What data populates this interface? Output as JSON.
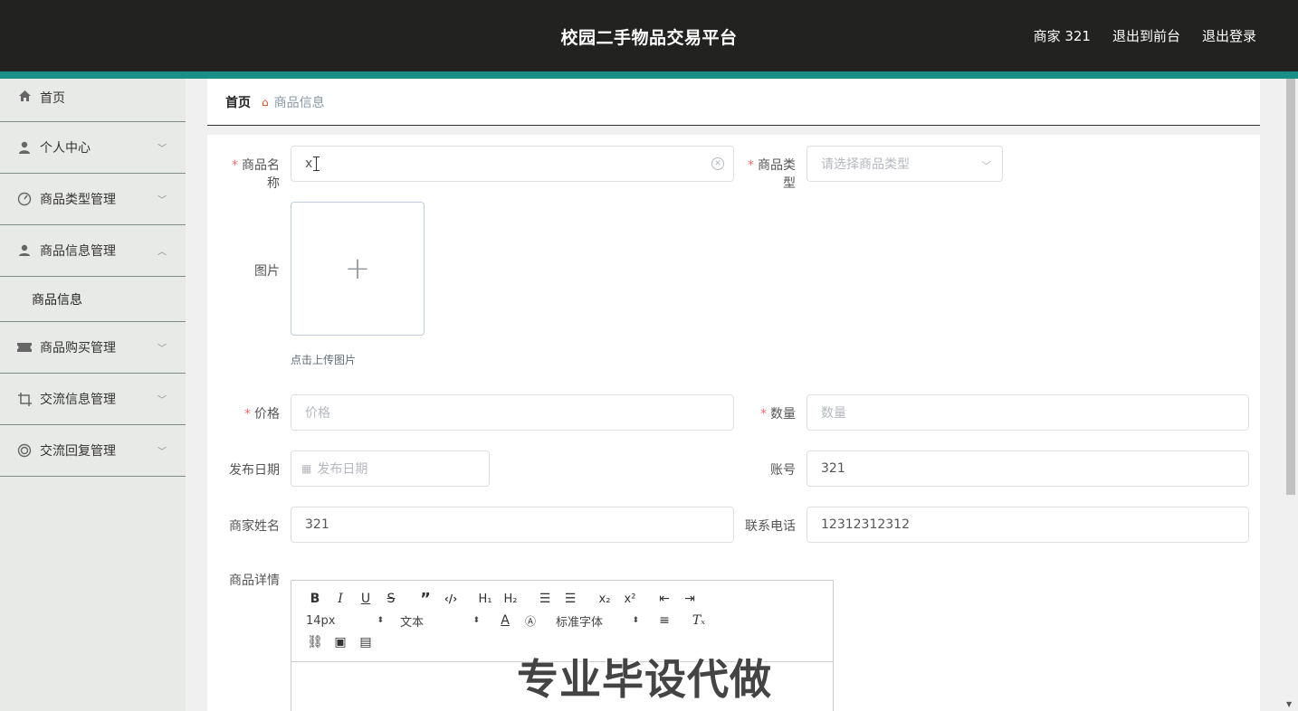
{
  "header": {
    "title": "校园二手物品交易平台",
    "user": "商家 321",
    "front_link": "退出到前台",
    "logout_link": "退出登录"
  },
  "sidebar": {
    "items": [
      {
        "label": "首页",
        "icon": "home-icon"
      },
      {
        "label": "个人中心",
        "icon": "user-icon",
        "arrow": "down"
      },
      {
        "label": "商品类型管理",
        "icon": "dashboard-icon",
        "arrow": "down"
      },
      {
        "label": "商品信息管理",
        "icon": "user-icon",
        "arrow": "up"
      },
      {
        "label": "商品购买管理",
        "icon": "ticket-icon",
        "arrow": "down"
      },
      {
        "label": "交流信息管理",
        "icon": "crop-icon",
        "arrow": "down"
      },
      {
        "label": "交流回复管理",
        "icon": "circle-icon",
        "arrow": "down"
      }
    ],
    "submenu": "商品信息"
  },
  "breadcrumb": {
    "home": "首页",
    "current": "商品信息"
  },
  "form": {
    "name_label": "商品名称",
    "name_value": "x",
    "type_label": "商品类型",
    "type_placeholder": "请选择商品类型",
    "image_label": "图片",
    "upload_tip": "点击上传图片",
    "price_label": "价格",
    "price_placeholder": "价格",
    "qty_label": "数量",
    "qty_placeholder": "数量",
    "date_label": "发布日期",
    "date_placeholder": "发布日期",
    "account_label": "账号",
    "account_value": "321",
    "merchant_label": "商家姓名",
    "merchant_value": "321",
    "phone_label": "联系电话",
    "phone_value": "12312312312",
    "detail_label": "商品详情"
  },
  "editor": {
    "size": "14px",
    "format": "文本",
    "font": "标准字体"
  },
  "watermark": "专业毕设代做",
  "colors": {
    "header_bg": "#222321",
    "accent": "#1a8f85",
    "required": "#f56c6c"
  }
}
